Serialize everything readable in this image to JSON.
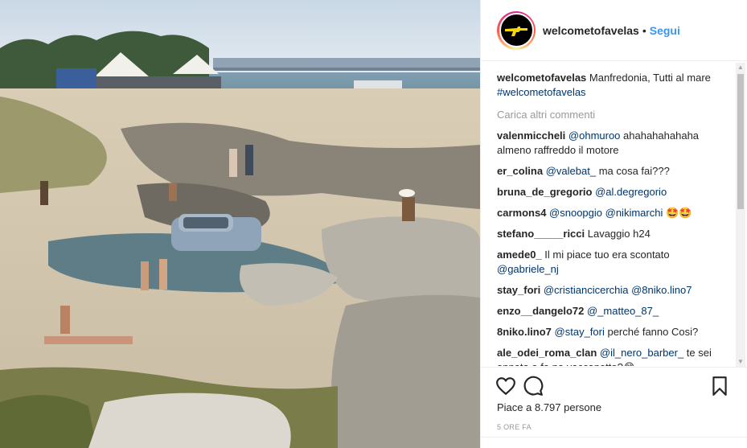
{
  "post": {
    "username": "welcometofavelas",
    "dot": "•",
    "follow_label": "Segui"
  },
  "caption": {
    "username": "welcometofavelas",
    "text": " Manfredonia, Tutti al mare ",
    "hashtag": "#welcometofavelas"
  },
  "load_more": "Carica altri commenti",
  "comments": [
    {
      "user": "valenmiccheli",
      "mention": "@ohmuroo",
      "text": " ahahahahahaha almeno raffreddo il motore"
    },
    {
      "user": "er_colina",
      "mention": "@valebat_",
      "text": " ma cosa fai???"
    },
    {
      "user": "bruna_de_gregorio",
      "mention": "@al.degregorio",
      "text": ""
    },
    {
      "user": "carmons4",
      "mention": "@snoopgio @nikimarchi",
      "text": " 🤩🤩"
    },
    {
      "user": "stefano_____ricci",
      "mention": "",
      "text": " Lavaggio h24"
    },
    {
      "user": "amede0_",
      "mention": "",
      "text": " Il mi piace tuo era scontato ",
      "mention2": "@gabriele_nj"
    },
    {
      "user": "stay_fori",
      "mention": "@cristiancicerchia @8niko.lino7",
      "text": ""
    },
    {
      "user": "enzo__dangelo72",
      "mention": "@_matteo_87_",
      "text": ""
    },
    {
      "user": "8niko.lino7",
      "mention": "@stay_fori",
      "text": " perché fanno Cosi?"
    },
    {
      "user": "ale_odei_roma_clan",
      "mention": "@il_nero_barber_",
      "text": " te sei annata a fa na vaccanotta?😂"
    }
  ],
  "likes_text": "Piace a 8.797 persone",
  "timestamp": "5 ORE FA",
  "icons": {
    "like": "heart-icon",
    "comment": "comment-icon",
    "save": "bookmark-icon",
    "avatar": "rifle-logo-icon"
  },
  "colors": {
    "follow": "#3897f0",
    "mention": "#003569",
    "muted": "#999999",
    "avatar_logo": "#f5d90a"
  }
}
